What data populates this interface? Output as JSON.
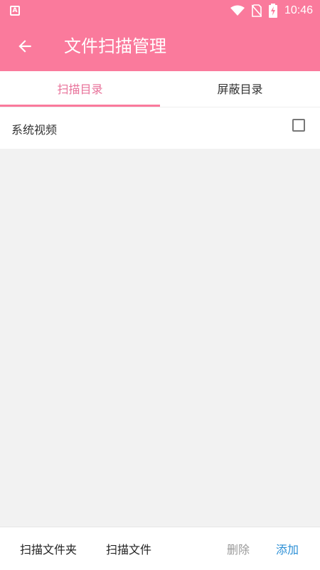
{
  "status_bar": {
    "time": "10:46",
    "icons": [
      "app-notification-icon",
      "wifi-icon",
      "no-sim-icon",
      "battery-charging-icon"
    ]
  },
  "app_bar": {
    "title": "文件扫描管理",
    "back_icon": "arrow-left-icon"
  },
  "tabs": [
    {
      "label": "扫描目录",
      "active": true
    },
    {
      "label": "屏蔽目录",
      "active": false
    }
  ],
  "list": [
    {
      "label": "系统视频",
      "checked": false
    }
  ],
  "bottom_bar": {
    "scan_folder": "扫描文件夹",
    "scan_file": "扫描文件",
    "delete": "删除",
    "add": "添加"
  },
  "colors": {
    "primary": "#fa7a9c",
    "active_tab_text": "#e8729a",
    "add_text": "#2b8fd6",
    "disabled_text": "#9a9a9a"
  }
}
